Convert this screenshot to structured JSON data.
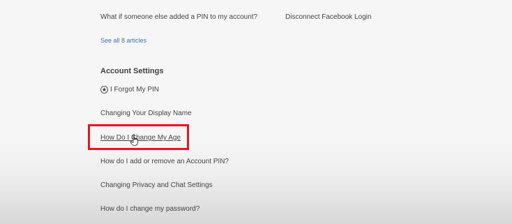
{
  "top_articles": {
    "left": "What if someone else added a PIN to my account?",
    "right": "Disconnect Facebook Login"
  },
  "see_all": "See all 8 articles",
  "account_settings": {
    "title": "Account Settings",
    "items": [
      {
        "label": "I Forgot My PIN"
      },
      {
        "label": "Changing Your Display Name"
      },
      {
        "label": "How Do I Change My Age"
      },
      {
        "label": "How do I add or remove an Account PIN?"
      },
      {
        "label": "Changing Privacy and Chat Settings"
      },
      {
        "label": "How do I change my password?"
      }
    ]
  },
  "icons": {
    "pin_item": "star-in-circle-icon",
    "cursor": "hand-pointer-icon"
  },
  "colors": {
    "link_blue": "#3f6fb5",
    "highlight_red": "#e8141c",
    "text_gray": "#444444"
  }
}
